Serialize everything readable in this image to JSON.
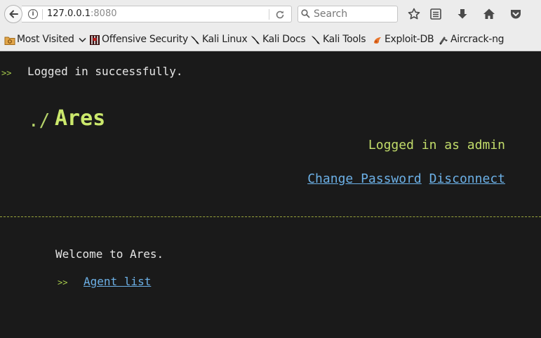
{
  "browser": {
    "url_host": "127.0.0.1",
    "url_port": ":8080",
    "search_placeholder": "Search"
  },
  "bookmarks": [
    {
      "label": "Most Visited",
      "icon": "most-visited-icon"
    },
    {
      "label": "Offensive Security",
      "icon": "offensive-security-icon"
    },
    {
      "label": "Kali Linux",
      "icon": "kali-dragon-icon"
    },
    {
      "label": "Kali Docs",
      "icon": "kali-dragon-icon"
    },
    {
      "label": "Kali Tools",
      "icon": "kali-dragon-icon"
    },
    {
      "label": "Exploit-DB",
      "icon": "exploit-db-icon"
    },
    {
      "label": "Aircrack-ng",
      "icon": "aircrack-icon"
    }
  ],
  "page": {
    "flash_marker": ">>",
    "flash_message": "Logged in successfully.",
    "logo_prefix": "./",
    "logo_name": "Ares",
    "user_status": "Logged in as admin",
    "change_password": "Change Password",
    "disconnect": "Disconnect",
    "welcome": "Welcome to Ares.",
    "agent_marker": ">>",
    "agent_list": "Agent list"
  },
  "colors": {
    "background": "#1a1a1a",
    "accent_green": "#cbe86c",
    "link_blue": "#6cb0e6"
  }
}
